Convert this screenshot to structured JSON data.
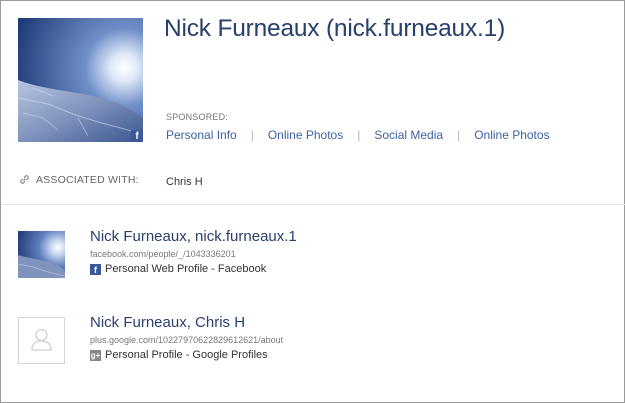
{
  "profile": {
    "name": "Nick Furneaux (nick.furneaux.1)",
    "photo_badge": "f",
    "sponsored_label": "SPONSORED:",
    "sponsored_links": [
      "Personal Info",
      "Online Photos",
      "Social Media",
      "Online Photos"
    ],
    "separator": "|"
  },
  "associated": {
    "label": "ASSOCIATED WITH:",
    "value": "Chris H"
  },
  "results": [
    {
      "title": "Nick Furneaux, nick.furneaux.1",
      "url": "facebook.com/people/_/1043336201",
      "source_icon": "f",
      "source": "Personal Web Profile - Facebook"
    },
    {
      "title": "Nick Furneaux, Chris H",
      "url": "plus.google.com/102279706228296126​21/about",
      "source_icon": "g+",
      "source": "Personal Profile - Google Profiles"
    }
  ],
  "colors": {
    "title": "#27406c",
    "link": "#3b63a3",
    "facebook": "#3b5998"
  }
}
